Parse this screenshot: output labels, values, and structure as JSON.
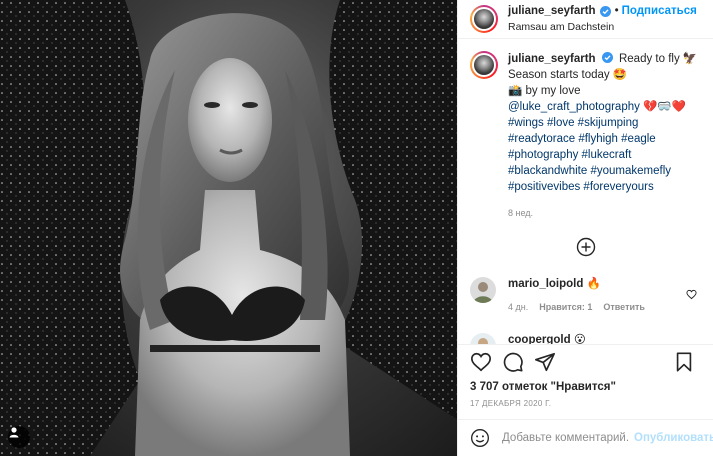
{
  "post": {
    "author": "juliane_seyfarth",
    "follow_label": "Подписаться",
    "location": "Ramsau am Dachstein"
  },
  "caption": {
    "author": "juliane_seyfarth",
    "line1": "Ready to fly 🦅",
    "line2": "Season starts today 🤩",
    "line3": "📸 by my love",
    "mention": "@luke_craft_photography",
    "mention_emoji": "💔🥽❤️",
    "hashtags": [
      "#wings #love #skijumping",
      "#readytorace #flyhigh #eagle",
      "#photography #lukecraft",
      "#blackandwhite #youmakemefly",
      "#positivevibes #foreveryours"
    ],
    "time": "8 нед."
  },
  "comments": [
    {
      "author": "mario_loipold",
      "text": "🔥",
      "time": "4 дн.",
      "likes": "Нравится: 1",
      "reply": "Ответить"
    },
    {
      "author": "coopergold",
      "text": "😮"
    }
  ],
  "likes_text": "3 707 отметок \"Нравится\"",
  "date_text": "17 ДЕКАБРЯ 2020 Г.",
  "add_comment": {
    "placeholder": "Добавьте комментарий...",
    "publish_label": "Опубликовать"
  },
  "icons": {
    "verified": "verified-badge-icon",
    "like": "heart-icon",
    "comment": "comment-bubble-icon",
    "share": "paper-plane-icon",
    "save": "bookmark-icon",
    "load_more": "plus-circle-icon",
    "emoji": "smiley-icon",
    "user_tag": "user-tag-icon"
  },
  "colors": {
    "link_blue": "#0095f6",
    "hashtag": "#00376b",
    "muted": "#8e8e8e",
    "publish_disabled": "#b2dffc"
  }
}
